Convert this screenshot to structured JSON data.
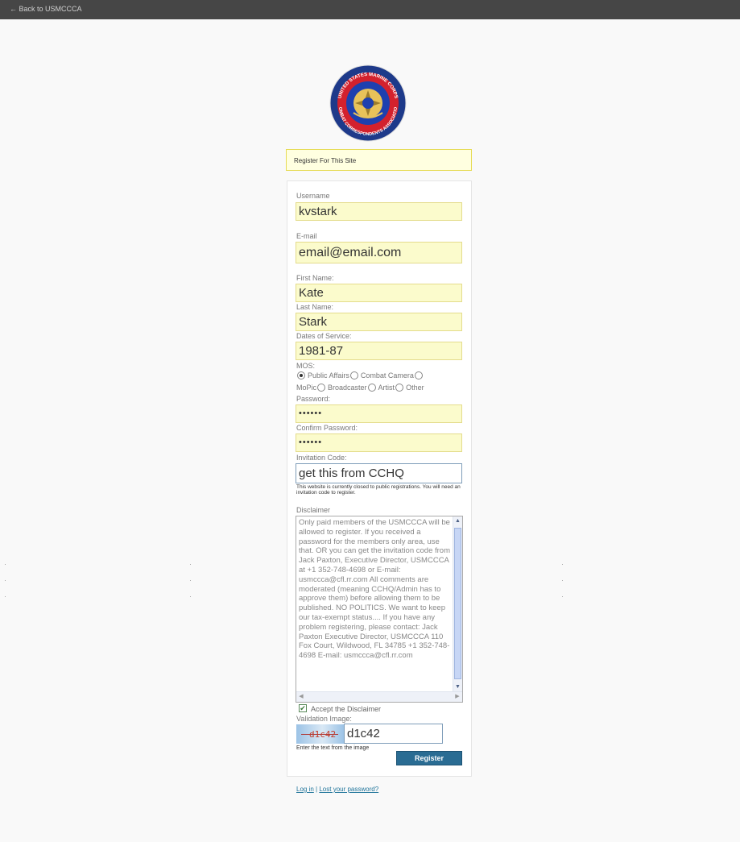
{
  "topbar": {
    "back_link": "← Back to USMCCCA"
  },
  "logo": {
    "ring_text_top": "UNITED STATES MARINE CORPS",
    "ring_text_bottom": "COMBAT CORRESPONDENTS ASSOCIATION",
    "colors": {
      "outer": "#1e3a8a",
      "ring": "#c8202a",
      "center": "#1e40af"
    }
  },
  "notice": {
    "text": "Register For This Site"
  },
  "form": {
    "username_label": "Username",
    "username_value": "kvstark",
    "email_label": "E-mail",
    "email_value": "email@email.com",
    "first_name_label": "First Name:",
    "first_name_value": "Kate",
    "last_name_label": "Last Name:",
    "last_name_value": "Stark",
    "dates_label": "Dates of Service:",
    "dates_value": "1981-87",
    "mos_label": "MOS:",
    "mos_options": [
      "Public Affairs",
      "Combat Camera",
      "MoPic",
      "Broadcaster",
      "Artist",
      "Other"
    ],
    "mos_selected": "Public Affairs",
    "password_label": "Password:",
    "password_value": "••••••",
    "confirm_label": "Confirm Password:",
    "confirm_value": "••••••",
    "invitation_label": "Invitation Code:",
    "invitation_value": "get this from CCHQ",
    "invitation_note": "This website is currently closed to public registrations. You will need an invitation code to register.",
    "disclaimer_label": "Disclaimer",
    "disclaimer_text": "Only paid members of the USMCCCA will be allowed to register. If you received a password for the members only area, use that. OR you can get the invitation code from Jack Paxton, Executive Director, USMCCCA at +1 352-748-4698 or E-mail: usmccca@cfl.rr.com All comments are moderated (meaning CCHQ/Admin has to approve them) before allowing them to be published. NO POLITICS. We want to keep our tax-exempt status.... If you have any problem registering, please contact: Jack Paxton Executive Director, USMCCCA 110 Fox Court, Wildwood, FL 34785 +1 352-748-4698 E-mail: usmccca@cfl.rr.com",
    "accept_label": "Accept the Disclaimer",
    "accept_checked": true,
    "validation_label": "Validation Image:",
    "captcha_text": "d1c42",
    "captcha_value": "d1c42",
    "validation_note": "Enter the text from the image",
    "register_button": "Register"
  },
  "footer": {
    "login_link": "Log in",
    "separator": "|",
    "lost_password_link": "Lost your password?"
  }
}
